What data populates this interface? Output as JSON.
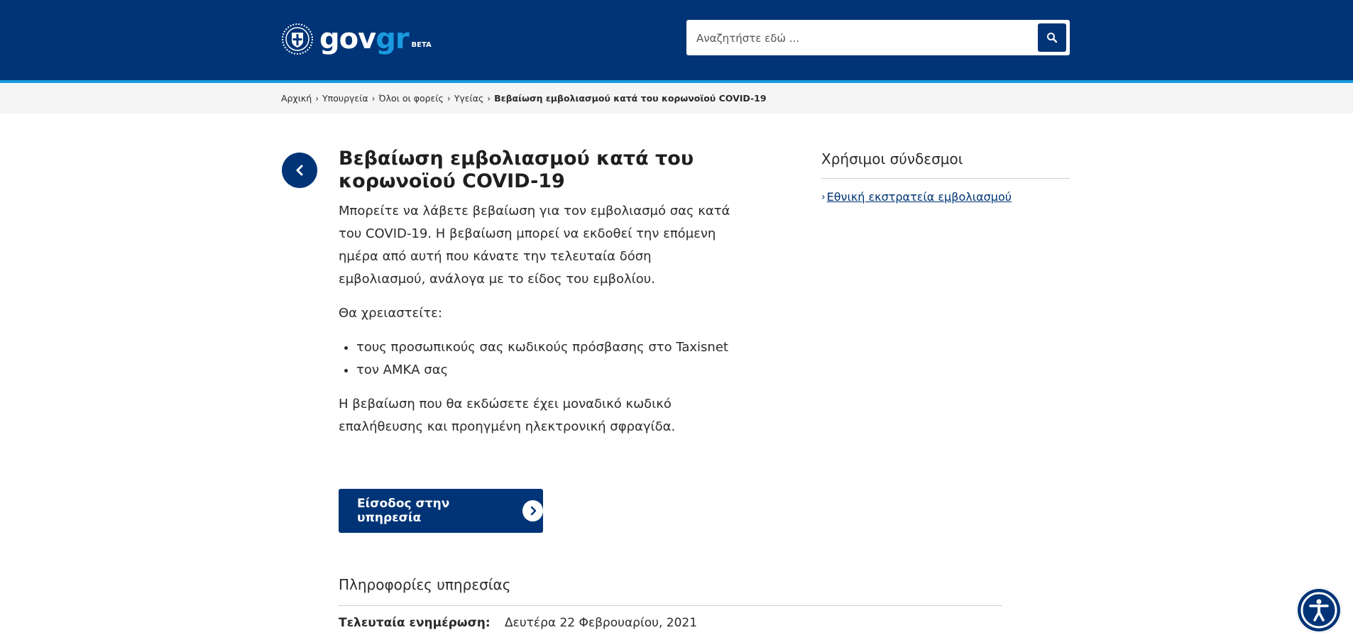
{
  "header": {
    "logo": {
      "gov": "gov",
      "gr": "gr",
      "beta": "BETA"
    },
    "search": {
      "placeholder": "Αναζητήστε εδώ ..."
    },
    "colors": {
      "primary": "#003476",
      "accent": "#1a9ae0"
    }
  },
  "breadcrumb": {
    "items": [
      "Αρχική",
      "Υπουργεία",
      "Όλοι οι φορείς",
      "Υγείας"
    ],
    "current": "Βεβαίωση εμβολιασμού κατά του κορωνοϊού COVID-19"
  },
  "main": {
    "title_line1": "Βεβαίωση εμβολιασμού κατά του",
    "title_line2": "κορωνοϊού COVID-19",
    "intro": "Μπορείτε να λάβετε βεβαίωση για τον εμβολιασμό σας κατά του COVID-19. Η βεβαίωση μπορεί να εκδοθεί την επόμενη ημέρα από αυτή που κάνατε την τελευταία δόση εμβολιασμού, ανάλογα με το είδος του εμβολίου.",
    "need_label": "Θα χρειαστείτε:",
    "requirements": [
      "τους προσωπικούς σας κωδικούς πρόσβασης στο Taxisnet",
      "τον ΑΜΚΑ σας"
    ],
    "closing": "Η βεβαίωση που θα εκδώσετε έχει μοναδικό κωδικό επαλήθευσης και προηγμένη ηλεκτρονική σφραγίδα.",
    "cta_label": "Είσοδος στην υπηρεσία",
    "info": {
      "heading": "Πληροφορίες υπηρεσίας",
      "last_updated_label": "Τελευταία ενημέρωση",
      "last_updated_value": "Δευτέρα 22 Φεβρουαρίου, 2021"
    }
  },
  "sidebar": {
    "title": "Χρήσιμοι σύνδεσμοι",
    "links": [
      "Εθνική εκστρατεία εμβολιασμού"
    ]
  }
}
